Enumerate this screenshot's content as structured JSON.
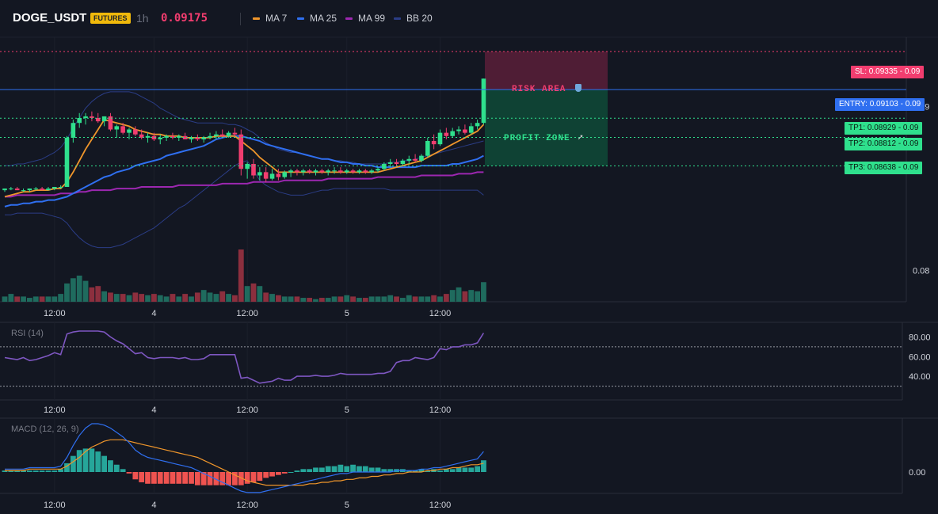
{
  "header": {
    "symbol": "DOGE_USDT",
    "badge": "FUTURES",
    "interval": "1h",
    "last_price": "0.09175",
    "indicators": [
      {
        "label": "MA 7",
        "color": "#f0962b"
      },
      {
        "label": "MA 25",
        "color": "#2f6ff0"
      },
      {
        "label": "MA 99",
        "color": "#9c27b0"
      },
      {
        "label": "BB 20",
        "color": "#2b3d86"
      }
    ]
  },
  "colors": {
    "up": "#26a69a",
    "down": "#ef5350",
    "candle_up": "#2fe08d",
    "candle_down": "#f23d6f",
    "risk": "#f23d6f",
    "profit": "#2fe08d",
    "entry": "#2f6ff0"
  },
  "price_levels": {
    "sl": "SL: 0.09335",
    "entry": "ENTRY: 0.09103",
    "tp1": "TP1: 0.08929",
    "tp2": "TP2: 0.08812",
    "tp3": "TP3: 0.08638",
    "suffix": "- 0.09"
  },
  "zones": {
    "risk_label": "RISK AREA",
    "profit_label": "PROFIT ZONE"
  },
  "axis": {
    "price_ticks": [
      "0.09",
      "0.08"
    ],
    "time_ticks": [
      "12:00",
      "4",
      "12:00",
      "5",
      "12:00"
    ]
  },
  "rsi": {
    "label": "RSI (14)",
    "ticks": [
      "80.00",
      "60.00",
      "40.00"
    ],
    "upper": 70,
    "lower": 30,
    "values": [
      59,
      58,
      57,
      59,
      56,
      57,
      59,
      61,
      64,
      62,
      83,
      85,
      86,
      86,
      86,
      86,
      85,
      80,
      76,
      73,
      68,
      63,
      64,
      59,
      58,
      59,
      59,
      59,
      58,
      59,
      57,
      57,
      58,
      62,
      62,
      62,
      62,
      62,
      38,
      39,
      36,
      33,
      34,
      35,
      38,
      36,
      36,
      40,
      40,
      40,
      41,
      40,
      40,
      41,
      43,
      42,
      42,
      42,
      42,
      42,
      43,
      43,
      45,
      54,
      56,
      56,
      59,
      58,
      57,
      59,
      68,
      67,
      70,
      70,
      72,
      72,
      74,
      84
    ]
  },
  "macd": {
    "label": "MACD (12, 26, 9)",
    "tick": "0.00",
    "macd_line": [
      2,
      2,
      2,
      2,
      3,
      3,
      3,
      3,
      3,
      4,
      10,
      18,
      25,
      30,
      33,
      33,
      32,
      30,
      27,
      24,
      20,
      15,
      12,
      10,
      9,
      8,
      7,
      6,
      5,
      4,
      3,
      1,
      -1,
      -3,
      -5,
      -7,
      -9,
      -11,
      -13,
      -14,
      -14,
      -14,
      -13,
      -12,
      -11,
      -10,
      -9,
      -8,
      -7,
      -6,
      -5,
      -4,
      -3,
      -2,
      -1,
      -1,
      0,
      0,
      0,
      0,
      0,
      0,
      0,
      1,
      1,
      1,
      1,
      2,
      2,
      3,
      3,
      4,
      5,
      6,
      7,
      8,
      9,
      14
    ],
    "signal_line": [
      1,
      1,
      1,
      1,
      2,
      2,
      2,
      2,
      2,
      2,
      4,
      7,
      10,
      14,
      17,
      19,
      21,
      22,
      22,
      22,
      21,
      20,
      19,
      18,
      17,
      16,
      15,
      14,
      13,
      12,
      11,
      10,
      8,
      6,
      4,
      2,
      0,
      -2,
      -4,
      -6,
      -7,
      -8,
      -9,
      -9,
      -9,
      -9,
      -9,
      -9,
      -9,
      -8,
      -8,
      -7,
      -7,
      -6,
      -6,
      -5,
      -5,
      -4,
      -4,
      -3,
      -3,
      -2,
      -2,
      -1,
      -1,
      0,
      0,
      0,
      1,
      1,
      2,
      2,
      3,
      3,
      4,
      5,
      5,
      6
    ],
    "hist": [
      1,
      1,
      1,
      1,
      1,
      1,
      1,
      1,
      1,
      2,
      6,
      11,
      15,
      16,
      16,
      14,
      11,
      8,
      5,
      2,
      -1,
      -5,
      -7,
      -8,
      -8,
      -8,
      -8,
      -8,
      -8,
      -8,
      -8,
      -9,
      -9,
      -9,
      -9,
      -9,
      -9,
      -9,
      -9,
      -8,
      -7,
      -6,
      -4,
      -3,
      -2,
      -1,
      0,
      1,
      2,
      2,
      3,
      3,
      4,
      4,
      5,
      4,
      5,
      4,
      4,
      3,
      3,
      2,
      2,
      2,
      2,
      1,
      1,
      2,
      1,
      2,
      1,
      2,
      2,
      3,
      3,
      3,
      4,
      8
    ]
  },
  "chart_data": {
    "type": "candlestick",
    "symbol": "DOGE_USDT",
    "interval": "1h",
    "x_labels": [
      "12:00",
      "4",
      "12:00",
      "5",
      "12:00"
    ],
    "ylim": [
      0.0795,
      0.0935
    ],
    "candles": [
      [
        0.0849,
        0.085,
        0.0848,
        0.085
      ],
      [
        0.085,
        0.0851,
        0.0849,
        0.085
      ],
      [
        0.085,
        0.0851,
        0.0849,
        0.0849
      ],
      [
        0.0849,
        0.085,
        0.0848,
        0.0849
      ],
      [
        0.0849,
        0.085,
        0.0848,
        0.085
      ],
      [
        0.085,
        0.0851,
        0.0849,
        0.085
      ],
      [
        0.085,
        0.0851,
        0.0849,
        0.0849
      ],
      [
        0.0849,
        0.0851,
        0.0849,
        0.085
      ],
      [
        0.085,
        0.0851,
        0.0849,
        0.0851
      ],
      [
        0.0851,
        0.0852,
        0.085,
        0.0851
      ],
      [
        0.0851,
        0.0882,
        0.0851,
        0.0881
      ],
      [
        0.0881,
        0.0892,
        0.0878,
        0.089
      ],
      [
        0.089,
        0.0896,
        0.0887,
        0.0893
      ],
      [
        0.0893,
        0.0896,
        0.0889,
        0.0894
      ],
      [
        0.0894,
        0.0897,
        0.0891,
        0.0893
      ],
      [
        0.0893,
        0.0896,
        0.089,
        0.0891
      ],
      [
        0.0891,
        0.0894,
        0.0888,
        0.0894
      ],
      [
        0.0894,
        0.0896,
        0.0885,
        0.0886
      ],
      [
        0.0886,
        0.0889,
        0.0881,
        0.0888
      ],
      [
        0.0888,
        0.089,
        0.0883,
        0.0884
      ],
      [
        0.0884,
        0.0887,
        0.088,
        0.0886
      ],
      [
        0.0886,
        0.0888,
        0.0882,
        0.0883
      ],
      [
        0.0883,
        0.0886,
        0.088,
        0.0881
      ],
      [
        0.0881,
        0.0884,
        0.0878,
        0.0882
      ],
      [
        0.0882,
        0.0884,
        0.0879,
        0.088
      ],
      [
        0.088,
        0.0883,
        0.0877,
        0.0881
      ],
      [
        0.0881,
        0.0883,
        0.0879,
        0.0882
      ],
      [
        0.0882,
        0.0884,
        0.088,
        0.0881
      ],
      [
        0.0881,
        0.0883,
        0.0879,
        0.0882
      ],
      [
        0.0882,
        0.0884,
        0.088,
        0.088
      ],
      [
        0.088,
        0.0882,
        0.0878,
        0.0881
      ],
      [
        0.0881,
        0.0883,
        0.0879,
        0.088
      ],
      [
        0.088,
        0.0882,
        0.0878,
        0.0881
      ],
      [
        0.0881,
        0.0884,
        0.088,
        0.0882
      ],
      [
        0.0882,
        0.0885,
        0.088,
        0.0883
      ],
      [
        0.0883,
        0.0886,
        0.0881,
        0.0882
      ],
      [
        0.0882,
        0.0885,
        0.0881,
        0.0884
      ],
      [
        0.0884,
        0.0887,
        0.0882,
        0.0883
      ],
      [
        0.0883,
        0.0886,
        0.0858,
        0.0862
      ],
      [
        0.0862,
        0.0866,
        0.0856,
        0.0865
      ],
      [
        0.0865,
        0.0868,
        0.0856,
        0.0858
      ],
      [
        0.0858,
        0.0863,
        0.0855,
        0.086
      ],
      [
        0.086,
        0.0863,
        0.0854,
        0.0856
      ],
      [
        0.0856,
        0.0862,
        0.0855,
        0.0859
      ],
      [
        0.0859,
        0.0862,
        0.0855,
        0.0857
      ],
      [
        0.0857,
        0.0861,
        0.0856,
        0.086
      ],
      [
        0.086,
        0.0862,
        0.0857,
        0.0861
      ],
      [
        0.0861,
        0.0862,
        0.0858,
        0.086
      ],
      [
        0.086,
        0.0862,
        0.0858,
        0.0861
      ],
      [
        0.0861,
        0.0862,
        0.0859,
        0.086
      ],
      [
        0.086,
        0.0862,
        0.0858,
        0.0861
      ],
      [
        0.0861,
        0.0862,
        0.0859,
        0.086
      ],
      [
        0.086,
        0.0862,
        0.0858,
        0.0861
      ],
      [
        0.0861,
        0.0863,
        0.0859,
        0.0861
      ],
      [
        0.0861,
        0.0863,
        0.0859,
        0.086
      ],
      [
        0.086,
        0.0862,
        0.0859,
        0.0861
      ],
      [
        0.0861,
        0.0862,
        0.0859,
        0.086
      ],
      [
        0.086,
        0.0862,
        0.0859,
        0.0861
      ],
      [
        0.0861,
        0.0862,
        0.0859,
        0.086
      ],
      [
        0.086,
        0.0862,
        0.0859,
        0.0861
      ],
      [
        0.0861,
        0.0863,
        0.086,
        0.0862
      ],
      [
        0.0862,
        0.0866,
        0.0861,
        0.0865
      ],
      [
        0.0865,
        0.0868,
        0.0863,
        0.0866
      ],
      [
        0.0866,
        0.0868,
        0.0864,
        0.0865
      ],
      [
        0.0865,
        0.0868,
        0.0864,
        0.0867
      ],
      [
        0.0867,
        0.087,
        0.0865,
        0.0868
      ],
      [
        0.0868,
        0.0871,
        0.0866,
        0.0867
      ],
      [
        0.0867,
        0.0871,
        0.0866,
        0.087
      ],
      [
        0.087,
        0.0881,
        0.0869,
        0.0879
      ],
      [
        0.0879,
        0.0883,
        0.0874,
        0.0877
      ],
      [
        0.0877,
        0.0886,
        0.0876,
        0.0884
      ],
      [
        0.0884,
        0.0887,
        0.088,
        0.0882
      ],
      [
        0.0882,
        0.0887,
        0.0881,
        0.0885
      ],
      [
        0.0885,
        0.0888,
        0.0883,
        0.0886
      ],
      [
        0.0886,
        0.0889,
        0.0883,
        0.0884
      ],
      [
        0.0884,
        0.089,
        0.0883,
        0.0888
      ],
      [
        0.0888,
        0.0892,
        0.0886,
        0.089
      ],
      [
        0.089,
        0.0917,
        0.0889,
        0.0917
      ]
    ],
    "volume": [
      4,
      6,
      4,
      4,
      3,
      4,
      4,
      4,
      4,
      6,
      14,
      18,
      20,
      16,
      11,
      12,
      8,
      7,
      6,
      6,
      5,
      7,
      6,
      5,
      6,
      5,
      4,
      6,
      4,
      6,
      4,
      7,
      9,
      7,
      6,
      8,
      6,
      5,
      40,
      12,
      14,
      12,
      7,
      6,
      5,
      4,
      4,
      4,
      3,
      3,
      2,
      3,
      3,
      4,
      4,
      5,
      4,
      3,
      3,
      4,
      4,
      4,
      5,
      4,
      3,
      5,
      4,
      4,
      4,
      5,
      4,
      6,
      9,
      11,
      8,
      9,
      8,
      15
    ],
    "ma7": [
      0.0845,
      0.0846,
      0.0847,
      0.0848,
      0.0848,
      0.0849,
      0.0849,
      0.0849,
      0.085,
      0.085,
      0.0854,
      0.086,
      0.0867,
      0.0874,
      0.088,
      0.0886,
      0.0892,
      0.0891,
      0.089,
      0.0889,
      0.0888,
      0.0886,
      0.0885,
      0.0884,
      0.0883,
      0.0883,
      0.0882,
      0.0882,
      0.0882,
      0.0881,
      0.0881,
      0.0881,
      0.0881,
      0.0881,
      0.0882,
      0.0882,
      0.0882,
      0.0882,
      0.0879,
      0.0876,
      0.0873,
      0.0869,
      0.0866,
      0.0863,
      0.086,
      0.086,
      0.086,
      0.086,
      0.086,
      0.086,
      0.086,
      0.086,
      0.086,
      0.086,
      0.086,
      0.086,
      0.086,
      0.086,
      0.086,
      0.086,
      0.086,
      0.0861,
      0.0862,
      0.0863,
      0.0864,
      0.0865,
      0.0866,
      0.0867,
      0.0869,
      0.0871,
      0.0873,
      0.0875,
      0.0877,
      0.0879,
      0.0881,
      0.0883,
      0.0885,
      0.0889
    ],
    "ma25": [
      0.0839,
      0.084,
      0.084,
      0.0841,
      0.0841,
      0.0842,
      0.0842,
      0.0843,
      0.0843,
      0.0844,
      0.0845,
      0.0847,
      0.0849,
      0.0851,
      0.0853,
      0.0855,
      0.0857,
      0.0858,
      0.086,
      0.0861,
      0.0862,
      0.0864,
      0.0865,
      0.0866,
      0.0867,
      0.0868,
      0.087,
      0.0871,
      0.0872,
      0.0873,
      0.0874,
      0.0875,
      0.0876,
      0.0878,
      0.088,
      0.0881,
      0.0882,
      0.0882,
      0.0882,
      0.0881,
      0.088,
      0.0879,
      0.0877,
      0.0876,
      0.0875,
      0.0874,
      0.0873,
      0.0872,
      0.0871,
      0.087,
      0.0869,
      0.0868,
      0.0868,
      0.0867,
      0.0866,
      0.0866,
      0.0865,
      0.0865,
      0.0864,
      0.0864,
      0.0863,
      0.0863,
      0.0863,
      0.0863,
      0.0863,
      0.0863,
      0.0863,
      0.0864,
      0.0864,
      0.0864,
      0.0864,
      0.0864,
      0.0865,
      0.0865,
      0.0866,
      0.0867,
      0.0868,
      0.087
    ],
    "ma99": [
      0.0845,
      0.0845,
      0.0846,
      0.0846,
      0.0846,
      0.0846,
      0.0846,
      0.0846,
      0.0846,
      0.0847,
      0.0847,
      0.0847,
      0.0848,
      0.0848,
      0.0849,
      0.0849,
      0.0849,
      0.0849,
      0.085,
      0.085,
      0.085,
      0.085,
      0.0851,
      0.0851,
      0.0851,
      0.0851,
      0.0851,
      0.0851,
      0.0852,
      0.0852,
      0.0852,
      0.0852,
      0.0852,
      0.0852,
      0.0852,
      0.0853,
      0.0853,
      0.0853,
      0.0853,
      0.0853,
      0.0854,
      0.0854,
      0.0854,
      0.0854,
      0.0854,
      0.0855,
      0.0855,
      0.0855,
      0.0855,
      0.0855,
      0.0855,
      0.0855,
      0.0856,
      0.0856,
      0.0856,
      0.0856,
      0.0856,
      0.0856,
      0.0856,
      0.0856,
      0.0857,
      0.0857,
      0.0857,
      0.0857,
      0.0857,
      0.0857,
      0.0857,
      0.0858,
      0.0858,
      0.0858,
      0.0858,
      0.0858,
      0.0858,
      0.0859,
      0.0859,
      0.0859,
      0.086,
      0.086
    ],
    "bb_upper": [
      0.0864,
      0.0864,
      0.0865,
      0.0865,
      0.0866,
      0.0867,
      0.0868,
      0.087,
      0.0872,
      0.0875,
      0.088,
      0.0887,
      0.0893,
      0.0899,
      0.0903,
      0.0906,
      0.0908,
      0.0909,
      0.0909,
      0.0909,
      0.0909,
      0.0908,
      0.0906,
      0.0904,
      0.0902,
      0.0899,
      0.0897,
      0.0895,
      0.0893,
      0.0892,
      0.0891,
      0.089,
      0.089,
      0.089,
      0.089,
      0.089,
      0.0889,
      0.0889,
      0.0888,
      0.0886,
      0.0884,
      0.0881,
      0.0878,
      0.0876,
      0.0874,
      0.0873,
      0.0872,
      0.0872,
      0.0871,
      0.087,
      0.0869,
      0.0868,
      0.0868,
      0.0867,
      0.0867,
      0.0866,
      0.0866,
      0.0865,
      0.0865,
      0.0865,
      0.0865,
      0.0865,
      0.0866,
      0.0866,
      0.0867,
      0.0867,
      0.0868,
      0.0869,
      0.087,
      0.0871,
      0.0872,
      0.0873,
      0.0874,
      0.0875,
      0.0876,
      0.0877,
      0.0878,
      0.0879
    ],
    "bb_lower": [
      0.0834,
      0.0834,
      0.0835,
      0.0835,
      0.0835,
      0.0835,
      0.0835,
      0.0834,
      0.0833,
      0.0832,
      0.0829,
      0.0824,
      0.082,
      0.0817,
      0.0815,
      0.0814,
      0.0814,
      0.0814,
      0.0815,
      0.0816,
      0.0818,
      0.082,
      0.0822,
      0.0824,
      0.0826,
      0.0829,
      0.0832,
      0.0835,
      0.0838,
      0.084,
      0.0843,
      0.0846,
      0.0849,
      0.0852,
      0.0855,
      0.0858,
      0.0861,
      0.0864,
      0.0866,
      0.0867,
      0.0861,
      0.0855,
      0.0852,
      0.085,
      0.0848,
      0.0847,
      0.0846,
      0.0846,
      0.0846,
      0.0847,
      0.0848,
      0.0849,
      0.0849,
      0.085,
      0.085,
      0.085,
      0.085,
      0.085,
      0.085,
      0.085,
      0.085,
      0.085,
      0.0849,
      0.0849,
      0.0849,
      0.0849,
      0.0849,
      0.0849,
      0.0849,
      0.0849,
      0.0849,
      0.0849,
      0.0849,
      0.0849,
      0.0849,
      0.0849,
      0.0849,
      0.0846
    ]
  }
}
